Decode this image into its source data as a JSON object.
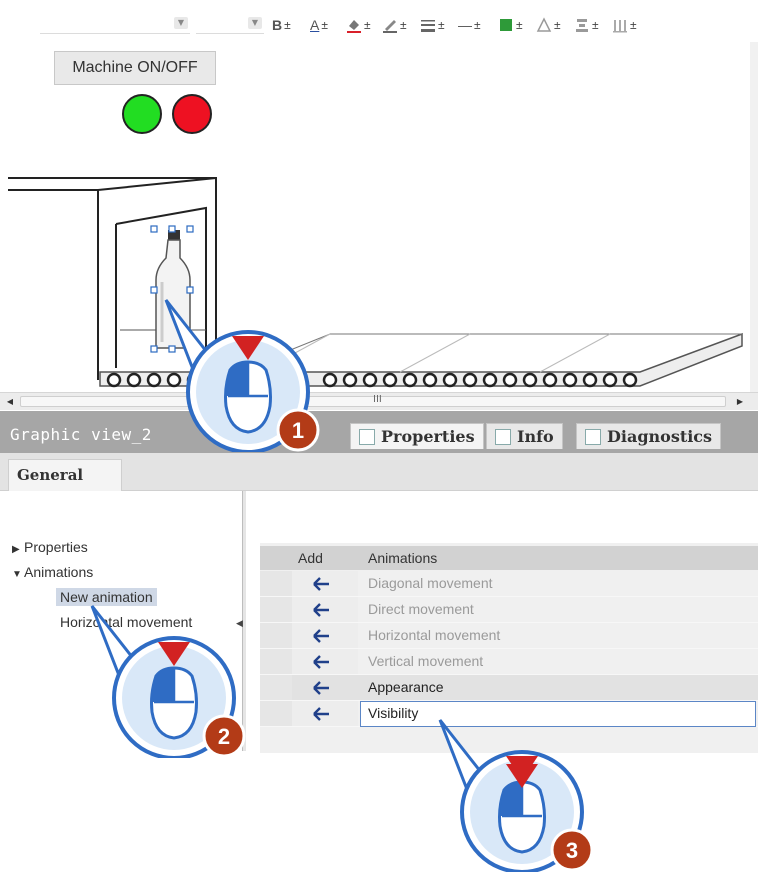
{
  "toolbar": {
    "bold_label": "B",
    "plusminus": "±",
    "text_color_label": "A",
    "line_solid_label": "—"
  },
  "canvas": {
    "machine_button_label": "Machine ON/OFF",
    "lamp_colors": {
      "on": "#22dd22",
      "off": "#ee1122"
    },
    "scroll_thumb_grip": "III"
  },
  "inspector": {
    "view_title": "Graphic view_2",
    "tabs": [
      {
        "label": "Properties",
        "active": true
      },
      {
        "label": "Info",
        "active": false
      },
      {
        "label": "Diagnostics",
        "active": false
      }
    ],
    "general_tab_label": "General"
  },
  "tree": {
    "items": [
      {
        "label": "Properties",
        "expanded": false
      },
      {
        "label": "Animations",
        "expanded": true
      }
    ],
    "children": [
      {
        "label": "New animation",
        "selected": true
      },
      {
        "label": "Horizontal movement",
        "selected": false
      }
    ]
  },
  "table": {
    "columns": [
      "Add",
      "Animations"
    ],
    "rows": [
      {
        "label": "Diagonal movement",
        "state": "disabled"
      },
      {
        "label": "Direct movement",
        "state": "disabled"
      },
      {
        "label": "Horizontal movement",
        "state": "disabled"
      },
      {
        "label": "Vertical movement",
        "state": "disabled"
      },
      {
        "label": "Appearance",
        "state": "group"
      },
      {
        "label": "Visibility",
        "state": "selected"
      }
    ]
  },
  "callouts": [
    {
      "number": "1"
    },
    {
      "number": "2"
    },
    {
      "number": "3"
    }
  ],
  "colors": {
    "callout_fill": "#d9e8f8",
    "callout_ring": "#2f6cc4",
    "callout_badge": "#b33b17",
    "click_arrow": "#d22222",
    "header_bg": "#a6a6a6"
  }
}
